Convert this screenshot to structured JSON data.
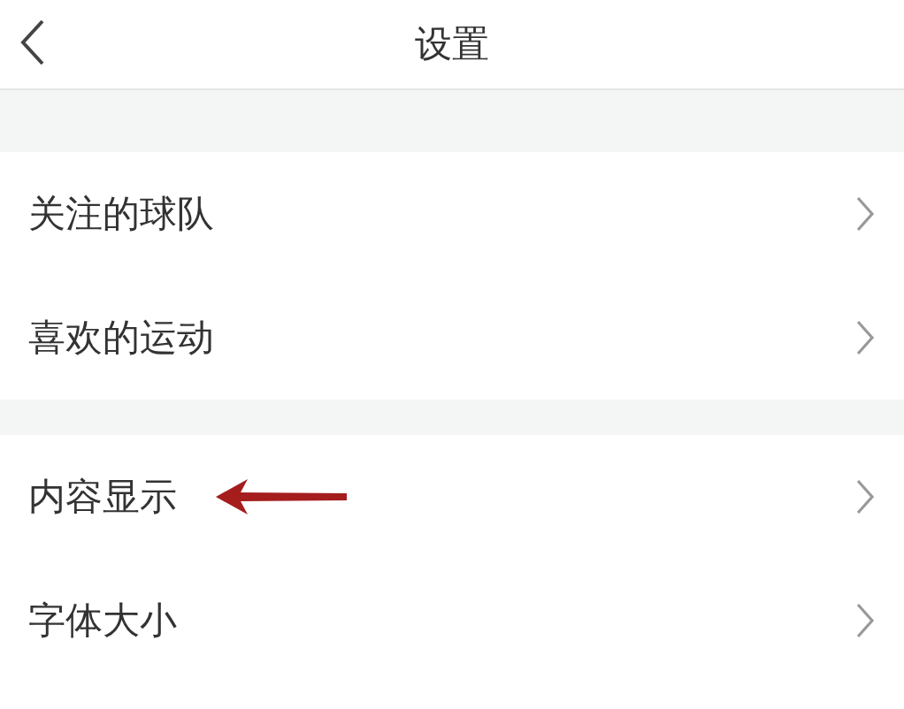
{
  "nav": {
    "title": "设置"
  },
  "sections": [
    {
      "items": [
        {
          "label": "关注的球队",
          "annotated": false
        },
        {
          "label": "喜欢的运动",
          "annotated": false
        }
      ]
    },
    {
      "items": [
        {
          "label": "内容显示",
          "annotated": true
        },
        {
          "label": "字体大小",
          "annotated": false
        }
      ]
    }
  ]
}
